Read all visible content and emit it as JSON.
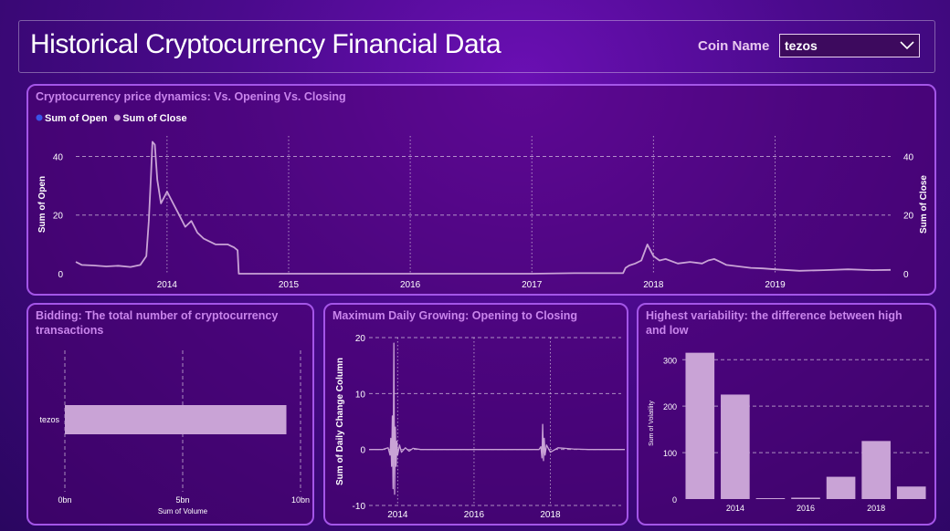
{
  "header": {
    "title": "Historical Cryptocurrency Financial Data",
    "coin_label": "Coin Name",
    "coin_value": "tezos"
  },
  "icons": {
    "dropdown": "chevron-down-icon"
  },
  "colors": {
    "accent": "#a456e8",
    "series": "#c9a3d6",
    "legend_open": "#3a55e8",
    "legend_close": "#c9a3d6"
  },
  "panels": {
    "price": {
      "title": "Cryptocurrency price dynamics: Vs. Opening Vs. Closing"
    },
    "bidding": {
      "title_line1": "Bidding: The total number of cryptocurrency",
      "title_line2": "transactions"
    },
    "growing": {
      "title": "Maximum Daily Growing: Opening to Closing"
    },
    "variability": {
      "title_line1": "Highest variability: the difference between high",
      "title_line2": "and low"
    }
  },
  "chart_data": [
    {
      "type": "line",
      "title": "Cryptocurrency price dynamics: Vs. Opening Vs. Closing",
      "ylabel_left": "Sum of Open",
      "ylabel_right": "Sum of Close",
      "legend": [
        "Sum of Open",
        "Sum of Close"
      ],
      "legend_position": "top-left",
      "x_ticks": [
        "2014",
        "2015",
        "2016",
        "2017",
        "2018",
        "2019"
      ],
      "y_ticks": [
        "0",
        "20",
        "40"
      ],
      "ylim": [
        0,
        47
      ],
      "xlim": [
        2013.25,
        2019.95
      ],
      "grid": true,
      "series": [
        {
          "name": "Sum of Close",
          "x": [
            2013.25,
            2013.3,
            2013.4,
            2013.5,
            2013.6,
            2013.7,
            2013.78,
            2013.83,
            2013.85,
            2013.87,
            2013.88,
            2013.9,
            2013.92,
            2013.95,
            2014.0,
            2014.05,
            2014.1,
            2014.15,
            2014.2,
            2014.25,
            2014.3,
            2014.35,
            2014.4,
            2014.5,
            2014.55,
            2014.58,
            2014.59,
            2015.0,
            2016.0,
            2017.0,
            2017.35,
            2017.75,
            2017.77,
            2017.8,
            2017.85,
            2017.9,
            2017.95,
            2018.0,
            2018.05,
            2018.1,
            2018.2,
            2018.3,
            2018.4,
            2018.45,
            2018.5,
            2018.55,
            2018.6,
            2018.7,
            2018.8,
            2018.9,
            2019.0,
            2019.2,
            2019.4,
            2019.6,
            2019.8,
            2019.95
          ],
          "values": [
            4,
            3,
            2.8,
            2.5,
            2.7,
            2.3,
            3,
            6,
            18,
            35,
            45,
            44,
            32,
            24,
            28,
            24,
            20,
            16,
            18,
            14,
            12,
            11,
            10,
            10,
            9,
            8,
            0,
            0,
            0,
            0,
            0.2,
            0.2,
            2,
            2.8,
            3.5,
            4.5,
            10,
            6,
            4.5,
            5,
            3.5,
            4,
            3.5,
            4.5,
            5,
            4,
            3,
            2.5,
            2,
            1.8,
            1.5,
            1,
            1.2,
            1.5,
            1.2,
            1.3
          ]
        }
      ]
    },
    {
      "type": "bar",
      "orientation": "horizontal",
      "title": "Bidding: The total number of cryptocurrency transactions",
      "categories": [
        "tezos"
      ],
      "values": [
        9.4
      ],
      "xlabel": "Sum of Volume",
      "x_ticks": [
        "0bn",
        "5bn",
        "10bn"
      ],
      "xlim": [
        0,
        10
      ]
    },
    {
      "type": "line",
      "title": "Maximum Daily Growing: Opening to Closing",
      "ylabel": "Sum of Daily Change Column",
      "x_ticks": [
        "2014",
        "2016",
        "2018"
      ],
      "y_ticks": [
        "-10",
        "0",
        "10",
        "20"
      ],
      "ylim": [
        -10,
        20
      ],
      "xlim": [
        2013.25,
        2019.95
      ],
      "series": [
        {
          "name": "Sum of Daily Change Column",
          "x": [
            2013.25,
            2013.6,
            2013.75,
            2013.8,
            2013.82,
            2013.84,
            2013.86,
            2013.88,
            2013.9,
            2013.92,
            2013.94,
            2013.96,
            2013.98,
            2014.0,
            2014.05,
            2014.1,
            2014.2,
            2014.3,
            2014.4,
            2014.6,
            2016.0,
            2017.7,
            2017.75,
            2017.78,
            2017.8,
            2017.82,
            2017.84,
            2017.86,
            2017.9,
            2018.0,
            2018.2,
            2018.6,
            2019.0,
            2019.95
          ],
          "values": [
            0,
            0,
            0.3,
            -1,
            2,
            -3,
            6,
            -7,
            19,
            -8,
            4,
            -3,
            1.5,
            -1,
            0.8,
            -0.5,
            0.3,
            -0.3,
            0.2,
            0,
            0,
            0,
            0.5,
            -1.5,
            4.5,
            -2,
            2,
            -1,
            0.8,
            -0.5,
            0.3,
            0.1,
            0,
            0
          ]
        }
      ]
    },
    {
      "type": "bar",
      "title": "Highest variability: the difference between high and low",
      "ylabel": "Sum of Volatility",
      "categories": [
        "2013",
        "2014",
        "2015",
        "2016",
        "2017",
        "2018",
        "2019"
      ],
      "x_ticks": [
        "2014",
        "2016",
        "2018"
      ],
      "y_ticks": [
        "0",
        "100",
        "200",
        "300"
      ],
      "values": [
        315,
        225,
        2,
        3,
        48,
        125,
        27
      ],
      "ylim": [
        0,
        330
      ]
    }
  ]
}
